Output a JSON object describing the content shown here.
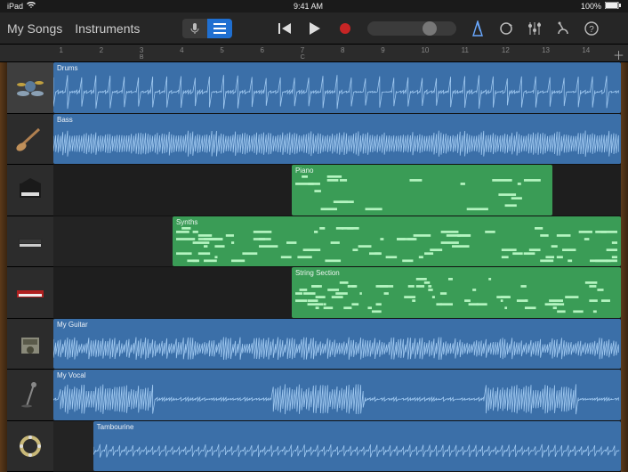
{
  "status": {
    "device": "iPad",
    "time": "9:41 AM",
    "battery": "100%"
  },
  "toolbar": {
    "my_songs": "My Songs",
    "instruments": "Instruments"
  },
  "ruler": {
    "markers": [
      {
        "pos": 1,
        "label": "1"
      },
      {
        "pos": 8,
        "label": "2"
      },
      {
        "pos": 15,
        "label": "3",
        "sub": "B"
      },
      {
        "pos": 22,
        "label": "4"
      },
      {
        "pos": 29,
        "label": "5"
      },
      {
        "pos": 36,
        "label": "6"
      },
      {
        "pos": 43,
        "label": "7",
        "sub": "C"
      },
      {
        "pos": 50,
        "label": "8"
      },
      {
        "pos": 57,
        "label": "9"
      },
      {
        "pos": 64,
        "label": "10"
      },
      {
        "pos": 71,
        "label": "11"
      },
      {
        "pos": 78,
        "label": "12"
      },
      {
        "pos": 85,
        "label": "13"
      },
      {
        "pos": 92,
        "label": "14"
      }
    ]
  },
  "tracks": [
    {
      "name": "Drums",
      "type": "audio",
      "instrument": "drums",
      "start": 0,
      "end": 100
    },
    {
      "name": "Bass",
      "type": "audio",
      "instrument": "bass",
      "start": 0,
      "end": 100
    },
    {
      "name": "Piano",
      "type": "midi",
      "instrument": "piano",
      "start": 42,
      "end": 88
    },
    {
      "name": "Synths",
      "type": "midi",
      "instrument": "synth",
      "start": 21,
      "end": 100
    },
    {
      "name": "String Section",
      "type": "midi",
      "instrument": "keys",
      "start": 42,
      "end": 100
    },
    {
      "name": "My Guitar",
      "type": "audio",
      "instrument": "amp",
      "start": 0,
      "end": 100
    },
    {
      "name": "My Vocal",
      "type": "audio",
      "instrument": "mic",
      "start": 0,
      "end": 100
    },
    {
      "name": "Tambourine",
      "type": "audio",
      "instrument": "tambourine",
      "start": 7,
      "end": 100
    }
  ],
  "colors": {
    "audio_region": "#3b6fa8",
    "midi_region": "#3a9c56",
    "accent": "#1f6fd1"
  }
}
